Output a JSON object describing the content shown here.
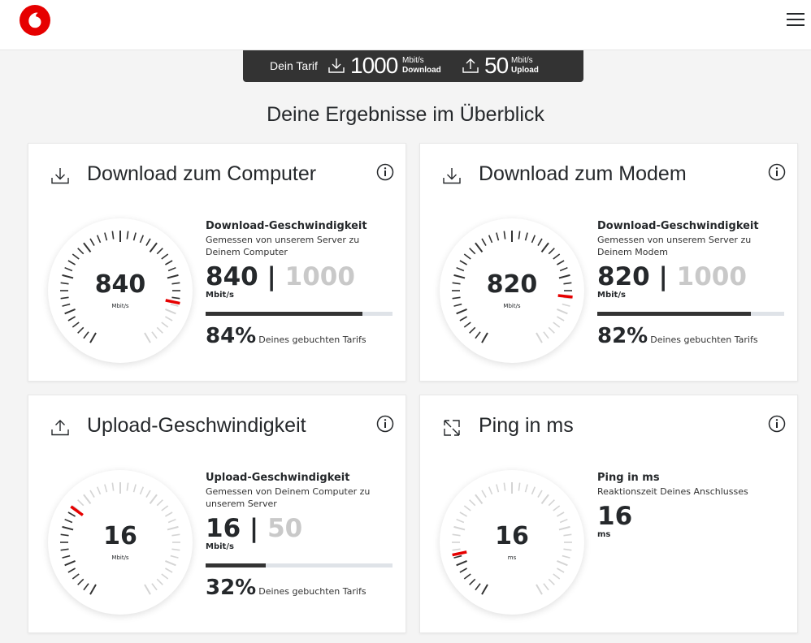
{
  "header": {
    "logo": "vodafone-logo",
    "menu_icon": "hamburger-menu-icon"
  },
  "tariff": {
    "label": "Dein Tarif",
    "download_value": "1000",
    "download_unit": "Mbit/s",
    "download_label": "Download",
    "upload_value": "50",
    "upload_unit": "Mbit/s",
    "upload_label": "Upload"
  },
  "heading": "Deine Ergebnisse im Überblick",
  "colors": {
    "accent": "#e60000",
    "dark": "#333333",
    "muted": "#c9c9c9"
  },
  "cards": {
    "download_computer": {
      "title": "Download zum Computer",
      "icon": "download-icon",
      "gauge_value": "840",
      "gauge_unit": "Mbit/s",
      "gauge_fraction": 0.84,
      "stat_title": "Download-Geschwindigkeit",
      "stat_desc": "Gemessen von unserem Server zu Deinem Computer",
      "value": "840",
      "separator": " | ",
      "max": "1000",
      "unit": "Mbit/s",
      "progress": 0.84,
      "percent": "84%",
      "percent_label": "Deines gebuchten Tarifs"
    },
    "download_modem": {
      "title": "Download zum Modem",
      "icon": "download-icon",
      "gauge_value": "820",
      "gauge_unit": "Mbit/s",
      "gauge_fraction": 0.82,
      "stat_title": "Download-Geschwindigkeit",
      "stat_desc": "Gemessen von unserem Server zu Deinem Modem",
      "value": "820",
      "separator": " | ",
      "max": "1000",
      "unit": "Mbit/s",
      "progress": 0.82,
      "percent": "82%",
      "percent_label": "Deines gebuchten Tarifs"
    },
    "upload": {
      "title": "Upload-Geschwindigkeit",
      "icon": "upload-icon",
      "gauge_value": "16",
      "gauge_unit": "Mbit/s",
      "gauge_fraction": 0.32,
      "stat_title": "Upload-Geschwindigkeit",
      "stat_desc": "Gemessen von Deinem Computer zu unserem Server",
      "value": "16",
      "separator": " | ",
      "max": "50",
      "unit": "Mbit/s",
      "progress": 0.32,
      "percent": "32%",
      "percent_label": "Deines gebuchten Tarifs"
    },
    "ping": {
      "title": "Ping in ms",
      "icon": "ping-arrows-icon",
      "gauge_value": "16",
      "gauge_unit": "ms",
      "gauge_fraction": 0.16,
      "stat_title": "Ping in ms",
      "stat_desc": "Reaktionszeit Deines Anschlusses",
      "value": "16",
      "unit": "ms"
    }
  }
}
